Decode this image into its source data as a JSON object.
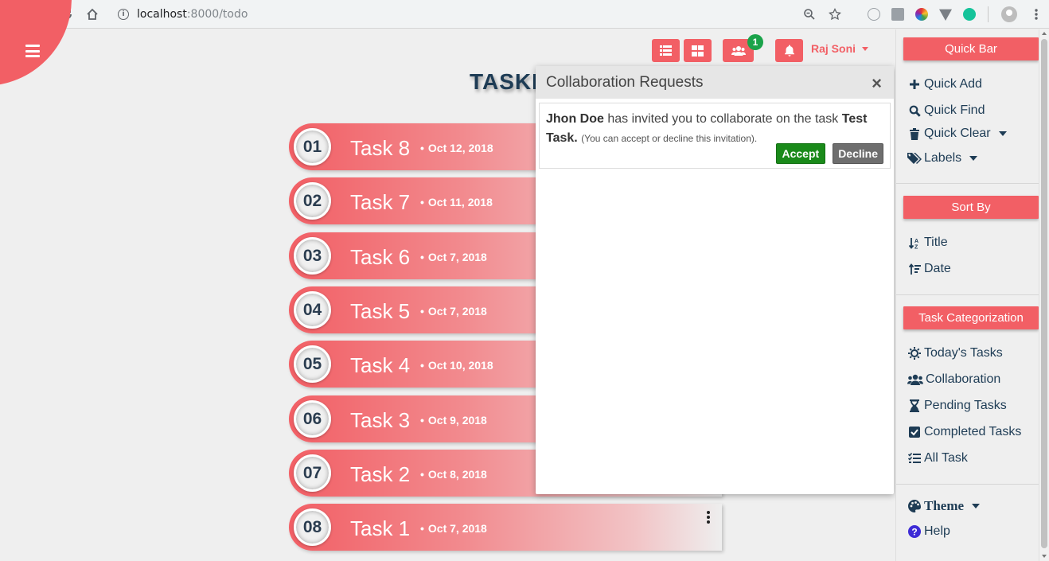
{
  "browser": {
    "url_host": "localhost",
    "url_path": ":8000/todo"
  },
  "header": {
    "user_name": "Raj Soni",
    "collab_badge_count": "1",
    "page_title": "TASKI"
  },
  "tasks": [
    {
      "number": "01",
      "title": "Task 8",
      "date": "Oct 12, 2018"
    },
    {
      "number": "02",
      "title": "Task 7",
      "date": "Oct 11, 2018"
    },
    {
      "number": "03",
      "title": "Task 6",
      "date": "Oct 7, 2018"
    },
    {
      "number": "04",
      "title": "Task 5",
      "date": "Oct 7, 2018"
    },
    {
      "number": "05",
      "title": "Task 4",
      "date": "Oct 10, 2018"
    },
    {
      "number": "06",
      "title": "Task 3",
      "date": "Oct 9, 2018"
    },
    {
      "number": "07",
      "title": "Task 2",
      "date": "Oct 8, 2018"
    },
    {
      "number": "08",
      "title": "Task 1",
      "date": "Oct 7, 2018"
    }
  ],
  "popup": {
    "title": "Collaboration Requests",
    "close": "×",
    "request": {
      "sender": "Jhon Doe",
      "message": " has invited you to collaborate on the task ",
      "task_name": "Test Task.",
      "note": "(You can accept or decline this invitation).",
      "accept_label": "Accept",
      "decline_label": "Decline"
    }
  },
  "sidebar": {
    "quick_bar": {
      "heading": "Quick Bar",
      "items": [
        {
          "label": "Quick Add",
          "icon": "plus-icon"
        },
        {
          "label": "Quick Find",
          "icon": "search-icon"
        },
        {
          "label": "Quick Clear",
          "icon": "trash-icon"
        },
        {
          "label": "Labels",
          "icon": "tags-icon"
        }
      ]
    },
    "sort_by": {
      "heading": "Sort By",
      "items": [
        {
          "label": "Title",
          "icon": "sort-alpha-icon"
        },
        {
          "label": "Date",
          "icon": "sort-amount-icon"
        }
      ]
    },
    "categorization": {
      "heading": "Task Categorization",
      "items": [
        {
          "label": "Today's Tasks",
          "icon": "sun-icon"
        },
        {
          "label": "Collaboration",
          "icon": "users-icon"
        },
        {
          "label": "Pending Tasks",
          "icon": "hourglass-icon"
        },
        {
          "label": "Completed Tasks",
          "icon": "check-square-icon"
        },
        {
          "label": "All Task",
          "icon": "tasks-icon"
        }
      ]
    },
    "theme_label": "Theme",
    "help_label": "Help"
  },
  "colors": {
    "accent": "#f25f65",
    "navy": "#1e3c55",
    "accept": "#1a8a1a",
    "decline": "#6e6e6e",
    "badge": "#1aa34a"
  }
}
